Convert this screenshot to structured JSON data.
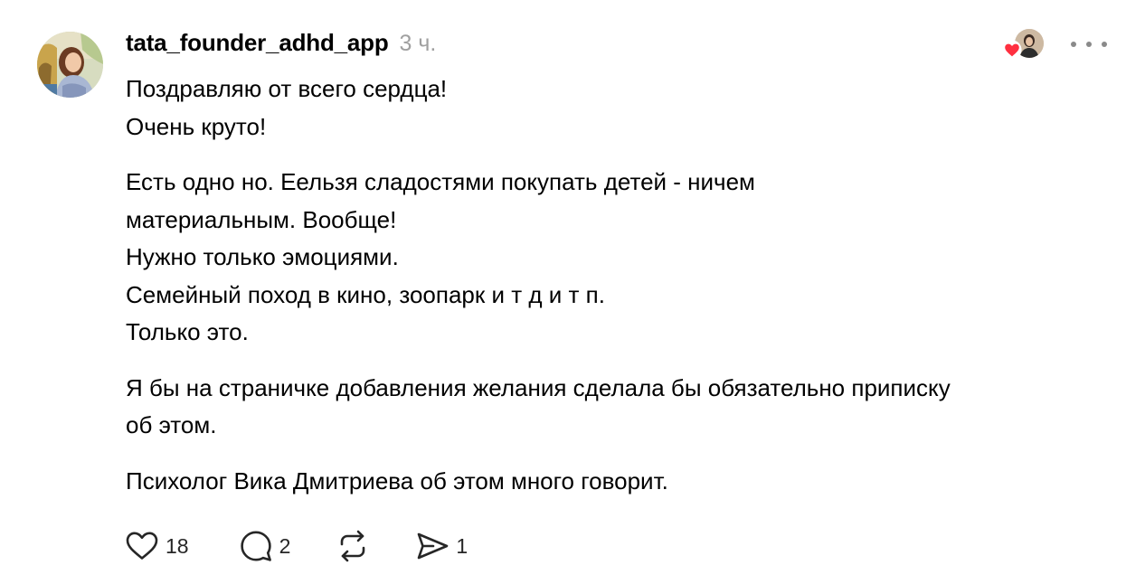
{
  "post": {
    "username": "tata_founder_adhd_app",
    "timestamp": "3 ч.",
    "paragraphs": [
      [
        "Поздравляю от всего сердца!",
        "Очень круто!"
      ],
      [
        "Есть одно но. Еельзя сладостями покупать детей - ничем",
        "материальным. Вообще!",
        "Нужно только эмоциями.",
        "Семейный поход в кино, зоопарк и т д и т п.",
        "Только это."
      ],
      [
        "Я бы на страничке добавления желания сделала бы обязательно приписку",
        "об этом."
      ],
      [
        "Психолог Вика Дмитриева об этом много говорит."
      ]
    ]
  },
  "actions": {
    "like_icon": "heart-icon",
    "like_count": "18",
    "reply_icon": "speech-bubble-icon",
    "reply_count": "2",
    "repost_icon": "repost-icon",
    "share_icon": "send-icon",
    "share_count": "1"
  },
  "colors": {
    "text": "#000000",
    "muted": "#a0a0a0",
    "icon": "#262626",
    "heart": "#ff3040"
  }
}
